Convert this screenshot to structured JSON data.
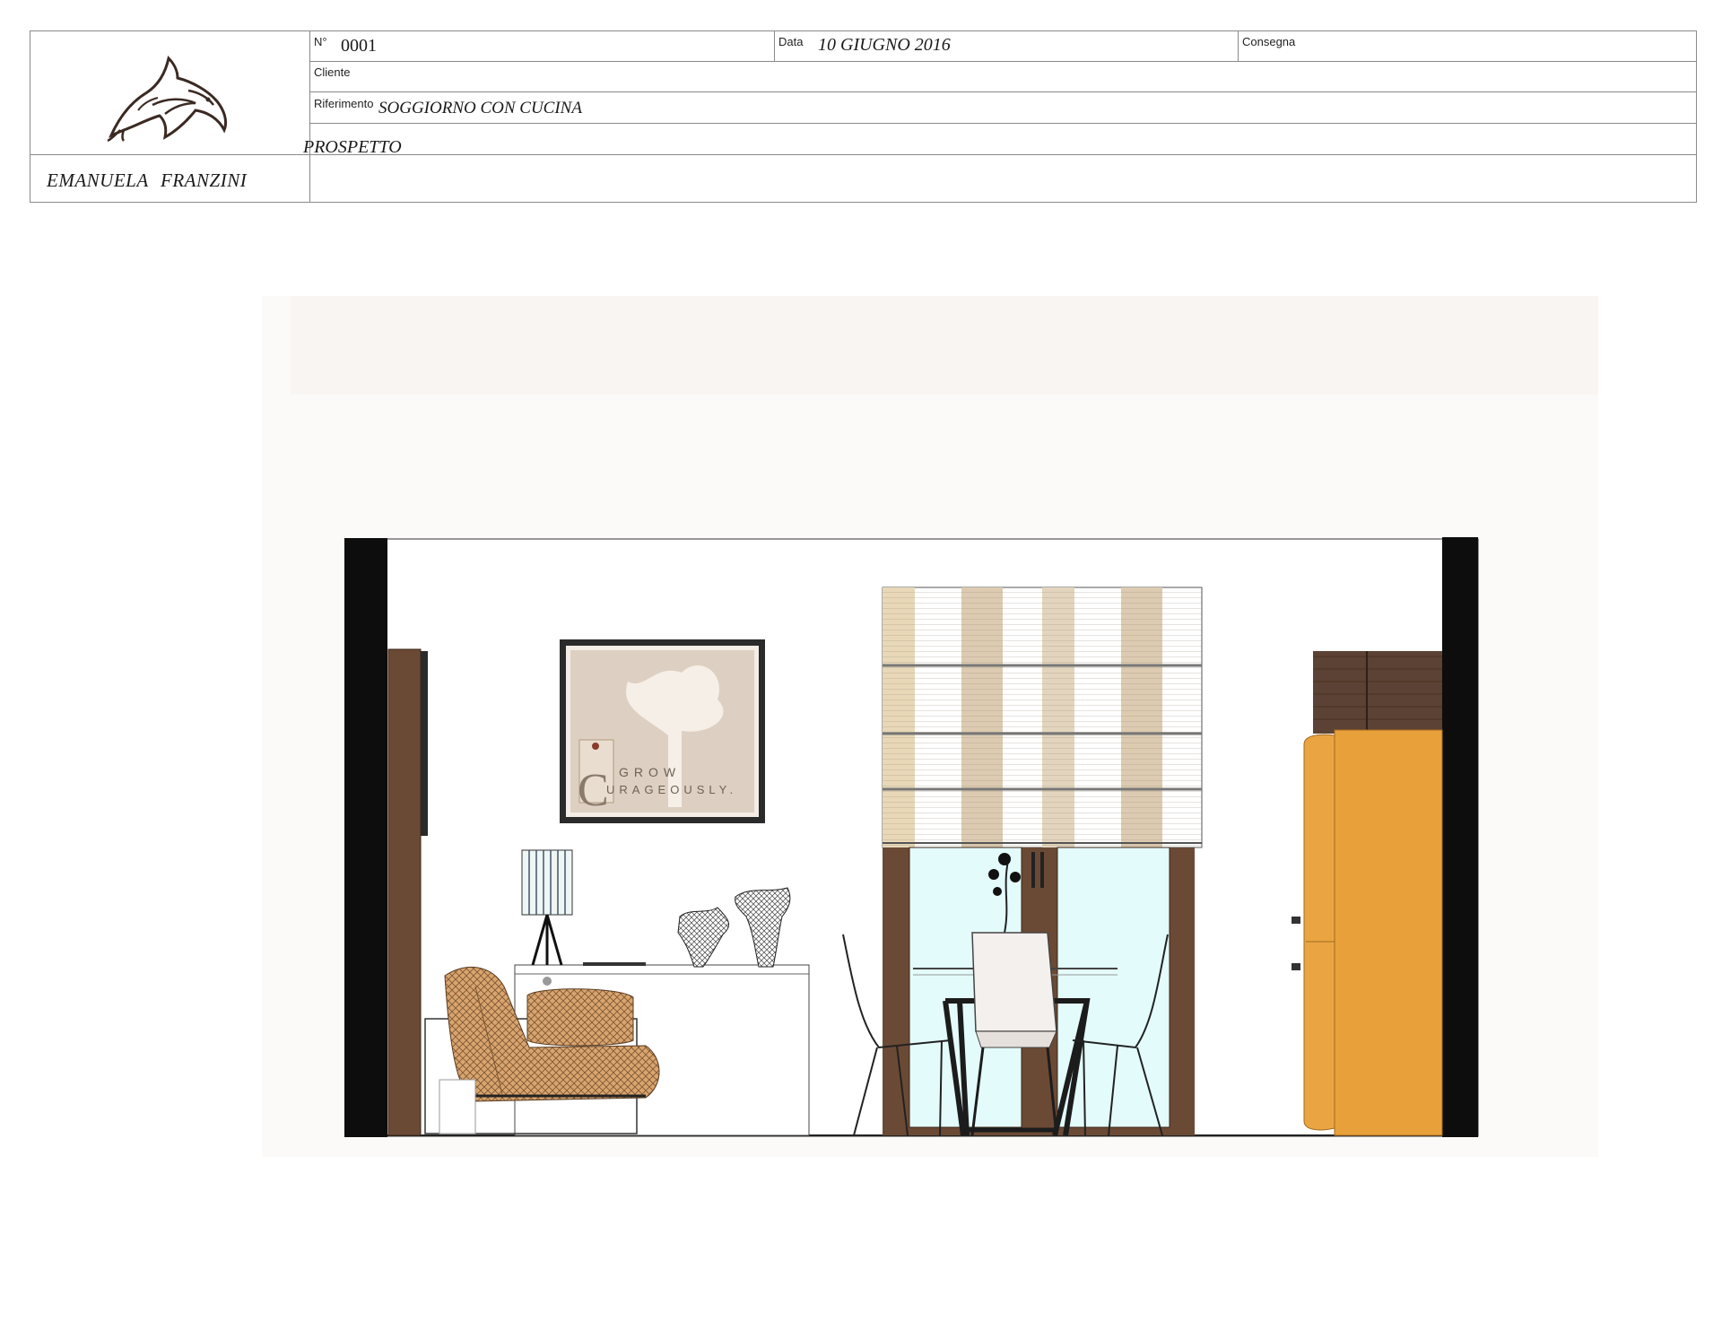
{
  "title_block": {
    "number_label": "N°",
    "number_value": "0001",
    "date_label": "Data",
    "date_value": "10 GIUGNO 2016",
    "delivery_label": "Consegna",
    "client_label": "Cliente",
    "reference_label": "Riferimento",
    "reference_value": "SOGGIORNO CON CUCINA",
    "designer": "EMANUELA   FRANZINI",
    "view": "PROSPETTO"
  },
  "drawing": {
    "artwork_text_top": "GROW",
    "artwork_text_bottom": "URAGEOUSLY.",
    "artwork_initial": "C"
  },
  "colors": {
    "wall_black": "#0d0d0d",
    "wood_dark": "#6b4a35",
    "fridge_orange": "#e8a03a",
    "glass_cyan": "#e4fbfb",
    "upholstery": "#d8a06a"
  }
}
